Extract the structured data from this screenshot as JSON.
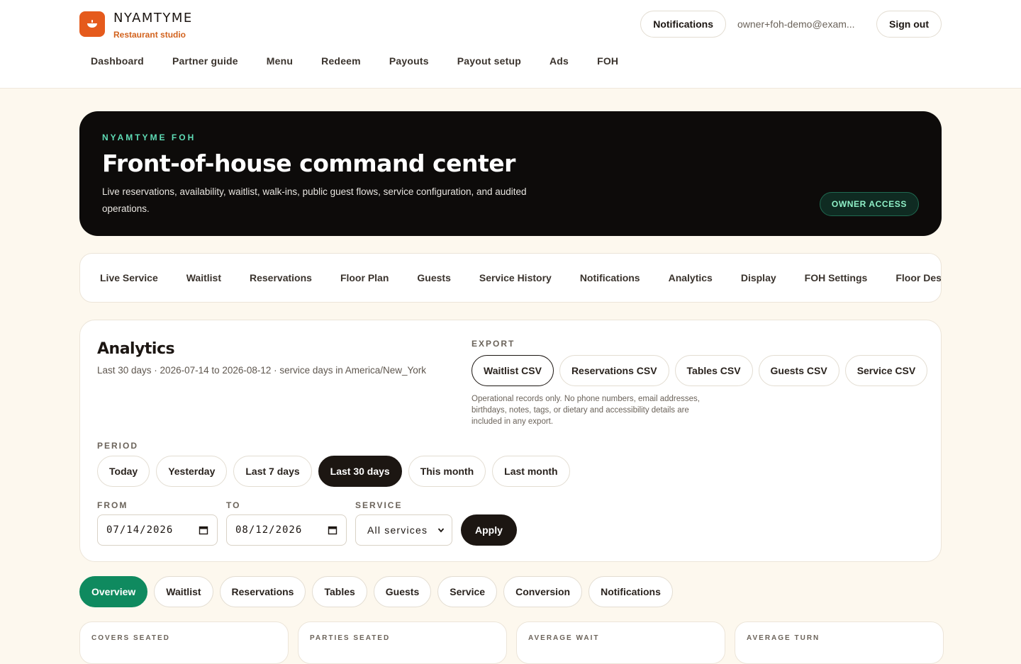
{
  "brand": {
    "name": "NYAMTYME",
    "subtitle": "Restaurant studio"
  },
  "header": {
    "notifications_label": "Notifications",
    "user_email": "owner+foh-demo@exam...",
    "sign_out_label": "Sign out"
  },
  "main_nav": [
    "Dashboard",
    "Partner guide",
    "Menu",
    "Redeem",
    "Payouts",
    "Payout setup",
    "Ads",
    "FOH"
  ],
  "hero": {
    "eyebrow": "NYAMTYME FOH",
    "title": "Front-of-house command center",
    "description": "Live reservations, availability, waitlist, walk-ins, public guest flows, service configuration, and audited operations.",
    "badge": "OWNER ACCESS"
  },
  "foh_tabs": [
    "Live Service",
    "Waitlist",
    "Reservations",
    "Floor Plan",
    "Guests",
    "Service History",
    "Notifications",
    "Analytics",
    "Display",
    "FOH Settings",
    "Floor Designer"
  ],
  "analytics": {
    "title": "Analytics",
    "subtitle": "Last 30 days · 2026-07-14 to 2026-08-12 · service days in America/New_York",
    "export": {
      "label": "EXPORT",
      "buttons": [
        "Waitlist CSV",
        "Reservations CSV",
        "Tables CSV",
        "Guests CSV",
        "Service CSV"
      ],
      "note": "Operational records only. No phone numbers, email addresses, birthdays, notes, tags, or dietary and accessibility details are included in any export."
    },
    "period": {
      "label": "PERIOD",
      "options": [
        "Today",
        "Yesterday",
        "Last 7 days",
        "Last 30 days",
        "This month",
        "Last month"
      ],
      "selected": "Last 30 days"
    },
    "filters": {
      "from_label": "FROM",
      "from_value": "07/14/2026",
      "to_label": "TO",
      "to_value": "08/12/2026",
      "service_label": "SERVICE",
      "service_value": "All services",
      "apply_label": "Apply"
    }
  },
  "sub_tabs": {
    "items": [
      "Overview",
      "Waitlist",
      "Reservations",
      "Tables",
      "Guests",
      "Service",
      "Conversion",
      "Notifications"
    ],
    "active": "Overview"
  },
  "stat_cards": [
    "COVERS SEATED",
    "PARTIES SEATED",
    "AVERAGE WAIT",
    "AVERAGE TURN"
  ],
  "colors": {
    "accent": "#e55a1c",
    "dark": "#1c1612",
    "green": "#0f8a5f",
    "background": "#fdf8ee"
  },
  "icons": {
    "logo": "bowl-icon",
    "date_picker": "calendar-icon",
    "select": "chevron-down-icon"
  }
}
